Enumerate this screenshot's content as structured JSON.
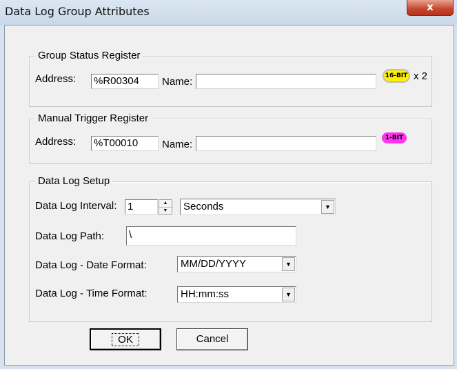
{
  "window": {
    "title": "Data Log Group Attributes",
    "close_label": "x"
  },
  "group_status": {
    "legend": "Group Status Register",
    "address_label": "Address:",
    "address_value": "%R00304",
    "name_label": "Name:",
    "name_value": "",
    "badge": "16-BIT",
    "multiplier": "x 2"
  },
  "manual_trigger": {
    "legend": "Manual Trigger Register",
    "address_label": "Address:",
    "address_value": "%T00010",
    "name_label": "Name:",
    "name_value": "",
    "badge": "1-BIT"
  },
  "setup": {
    "legend": "Data Log Setup",
    "interval_label": "Data Log Interval:",
    "interval_value": "1",
    "interval_unit": "Seconds",
    "path_label": "Data Log Path:",
    "path_value": "\\",
    "date_format_label": "Data Log  -  Date Format:",
    "date_format_value": "MM/DD/YYYY",
    "time_format_label": "Data Log  -  Time Format:",
    "time_format_value": "HH:mm:ss"
  },
  "buttons": {
    "ok": "OK",
    "cancel": "Cancel"
  },
  "colors": {
    "badge_16bit": "#ffee00",
    "badge_1bit": "#ff33ee",
    "close_button": "#c4452c"
  }
}
